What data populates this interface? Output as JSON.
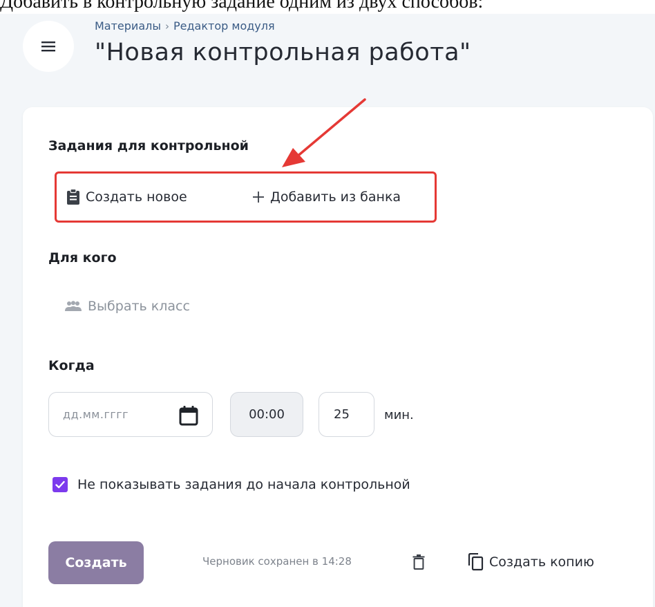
{
  "caption": "Добавить в контрольную задание одним из двух способов:",
  "header": {
    "breadcrumb": [
      "Материалы",
      "Редактор модуля"
    ],
    "breadcrumb_separator": "›",
    "title": "\"Новая контрольная работа\""
  },
  "tasks_section": {
    "title": "Задания для контрольной",
    "create_new_label": "Создать новое",
    "add_from_bank_label": "Добавить из банка"
  },
  "audience_section": {
    "title": "Для кого",
    "choose_class_label": "Выбрать класс"
  },
  "when_section": {
    "title": "Когда",
    "date_placeholder": "дд.мм.гггг",
    "time_value": "00:00",
    "duration_value": "25",
    "duration_unit": "мин."
  },
  "hide_tasks": {
    "checked": true,
    "label": "Не показывать задания до начала контрольной"
  },
  "footer": {
    "create_label": "Создать",
    "draft_status": "Черновик сохранен в 14:28",
    "copy_label": "Создать копию"
  },
  "colors": {
    "accent_purple": "#7c3aed",
    "create_button": "#8b7da3",
    "highlight_red": "#e53935",
    "breadcrumb_link": "#3a5b85"
  },
  "icons": [
    "menu-icon",
    "clipboard-icon",
    "plus-icon",
    "people-icon",
    "calendar-icon",
    "check-icon",
    "trash-icon",
    "copy-icon",
    "annotation-arrow"
  ]
}
